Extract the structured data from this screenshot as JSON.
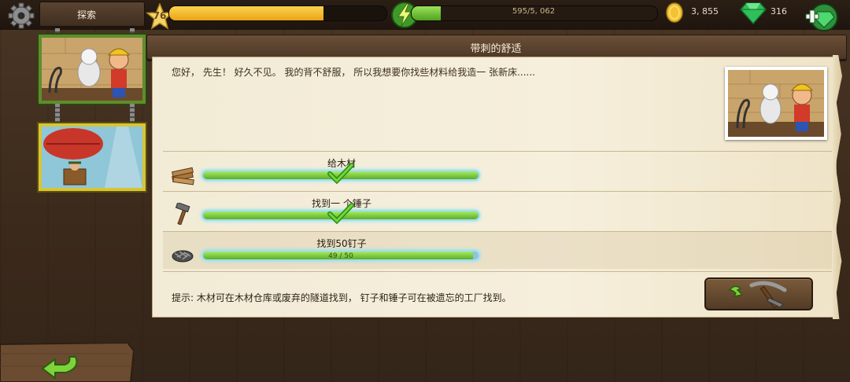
{
  "topbar": {
    "explore_label": "探索",
    "level": "76",
    "xp_progress": 0.71,
    "energy_text": "595/5, 062",
    "energy_progress": 0.12,
    "coins": "3, 855",
    "gems": "316"
  },
  "quest": {
    "title": "带刺的舒适",
    "story": "您好， 先生！  好久不见。  我的背不舒服， 所以我想要你找些材料给我造一 张新床......",
    "tasks": [
      {
        "label": "给木材",
        "icon": "wood-planks-icon",
        "progress": 1.0,
        "done": true,
        "count": ""
      },
      {
        "label": "找到一 个锤子",
        "icon": "hammer-icon",
        "progress": 1.0,
        "done": true,
        "count": ""
      },
      {
        "label": "找到50钉子",
        "icon": "nails-icon",
        "progress": 0.98,
        "done": false,
        "count": "49 / 50"
      }
    ],
    "hint": "提示: 木材可在木材仓库或废弃的隧道找到， 钉子和锤子可在被遗忘的工厂找到。"
  },
  "colors": {
    "progress_green": "#5dae28",
    "xp_gold": "#e8a318",
    "gem_green": "#2fbf5a"
  }
}
